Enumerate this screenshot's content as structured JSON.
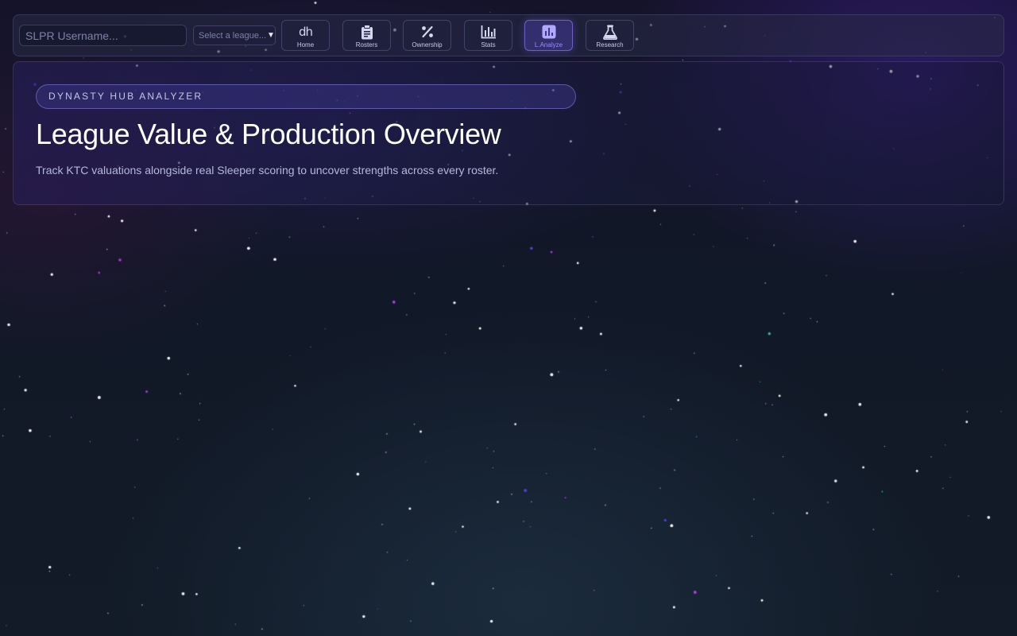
{
  "topbar": {
    "username_placeholder": "SLPR Username...",
    "league_select": {
      "selected": "Select a league...",
      "caret": "▼"
    },
    "nav": [
      {
        "label": "Home",
        "icon": "dh-logo-icon",
        "active": false
      },
      {
        "label": "Rosters",
        "icon": "clipboard-icon",
        "active": false
      },
      {
        "label": "Ownership",
        "icon": "percent-icon",
        "active": false
      },
      {
        "label": "Stats",
        "icon": "bar-chart-icon",
        "active": false
      },
      {
        "label": "L.Analyze",
        "icon": "analytics-icon",
        "active": true
      },
      {
        "label": "Research",
        "icon": "flask-icon",
        "active": false
      }
    ],
    "home_logo_text": "dh"
  },
  "hero": {
    "eyebrow": "DYNASTY HUB ANALYZER",
    "title": "League Value & Production Overview",
    "subtitle": "Track KTC valuations alongside real Sleeper scoring to uncover strengths across every roster."
  },
  "colors": {
    "accent": "#8b7cff",
    "background": "#121826",
    "panel_border": "#3a3c5e"
  }
}
